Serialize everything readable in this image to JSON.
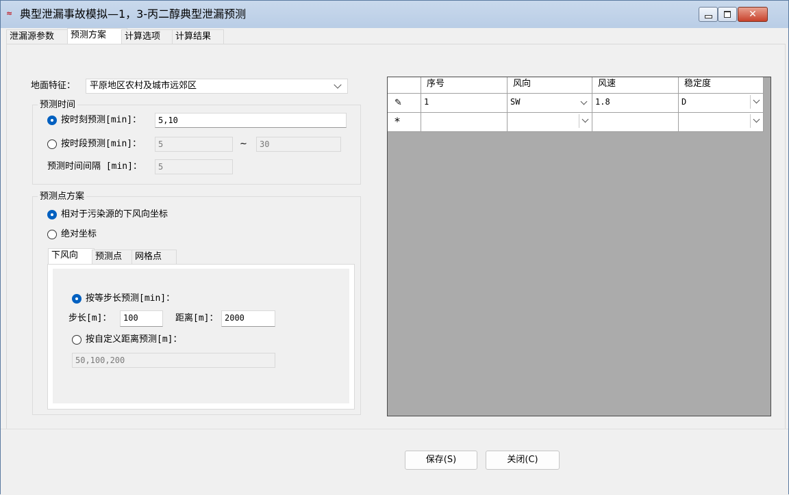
{
  "window": {
    "title": "典型泄漏事故模拟—1，3-丙二醇典型泄漏预测",
    "icon": "app-logo-icon",
    "close_glyph": "✕"
  },
  "tabs": [
    "泄漏源参数",
    "预测方案",
    "计算选项",
    "计算结果"
  ],
  "active_tab": "预测方案",
  "terrain": {
    "label": "地面特征：",
    "value": "平原地区农村及城市远郊区"
  },
  "time_group": {
    "title": "预测时间",
    "by_moment_label": "按时刻预测[min]：",
    "by_moment_value": "5,10",
    "by_moment_selected": true,
    "by_period_label": "按时段预测[min]：",
    "period_from": "5",
    "tilde": "~",
    "period_to": "30",
    "interval_label": "预测时间间隔 [min]：",
    "interval_value": "5"
  },
  "point_group": {
    "title": "预测点方案",
    "relative_label": "相对于污染源的下风向坐标",
    "relative_selected": true,
    "absolute_label": "绝对坐标",
    "subtabs": [
      "下风向",
      "预测点",
      "网格点"
    ],
    "active_subtab": "下风向",
    "equal_step_label": "按等步长预测[min]：",
    "step_label": "步长[m]：",
    "step_value": "100",
    "distance_label": "距离[m]：",
    "distance_value": "2000",
    "custom_label": "按自定义距离预测[m]：",
    "custom_value": "50,100,200"
  },
  "grid": {
    "columns": [
      "序号",
      "风向",
      "风速",
      "稳定度"
    ],
    "rows": [
      {
        "indicator": "pencil-icon",
        "seq": "1",
        "direction": "SW",
        "speed": "1.8",
        "stability": "D"
      }
    ],
    "new_row_glyph": "*"
  },
  "footer": {
    "save_label": "保存(S)",
    "close_label": "关闭(C)"
  },
  "colors": {
    "accent": "#0060c0",
    "grid_background": "#ababab",
    "title_bar": "#c9d9ec",
    "close_button": "#c8422c"
  }
}
